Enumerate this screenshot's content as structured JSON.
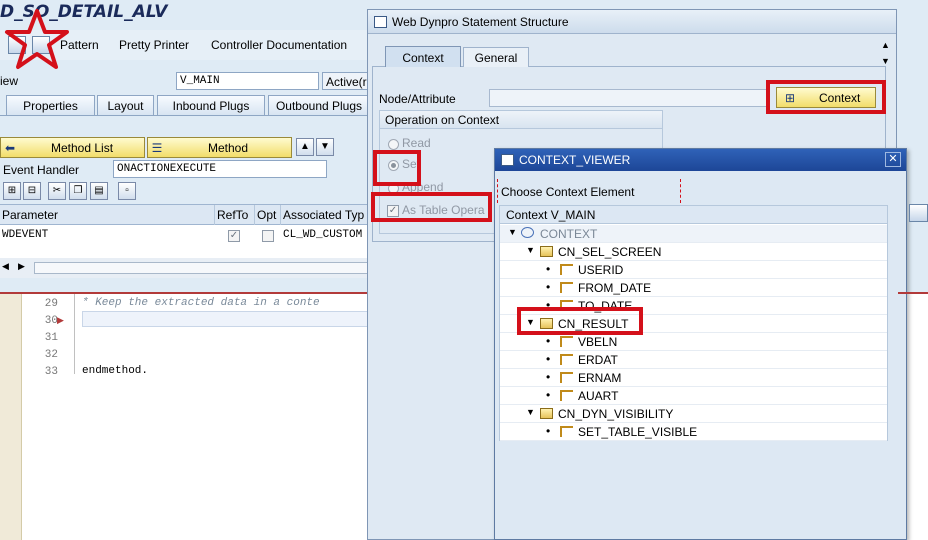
{
  "background": {
    "program_title": "D_SO_DETAIL_ALV",
    "toolbar": {
      "pattern": "Pattern",
      "pretty_printer": "Pretty Printer",
      "controller_documentation": "Controller Documentation"
    },
    "view_label": "iew",
    "view_value": "V_MAIN",
    "active_label": "Active(r",
    "tabs": [
      "Properties",
      "Layout",
      "Inbound Plugs",
      "Outbound Plugs"
    ],
    "method_list_button": "Method List",
    "method_button": "Method",
    "event_handler_label": "Event Handler",
    "event_handler_value": "ONACTIONEXECUTE",
    "param_grid": {
      "columns": [
        "Parameter",
        "RefTo",
        "Opt",
        "Associated Typ"
      ],
      "row": {
        "parameter": "WDEVENT",
        "refto": "✓",
        "opt": "",
        "associated_type": "CL_WD_CUSTOM"
      }
    },
    "editor": {
      "line_numbers": [
        "29",
        "30",
        "31",
        "32",
        "33"
      ],
      "comment_line": "* Keep the extracted data in a conte",
      "endmethod": "endmethod."
    }
  },
  "statement_dialog": {
    "title": "Web Dynpro Statement Structure",
    "tabs": {
      "context": "Context",
      "general": "General"
    },
    "node_attribute_label": "Node/Attribute",
    "context_button": "Context",
    "operation_group": {
      "title": "Operation on Context",
      "options": {
        "read": "Read",
        "set": "Set",
        "append": "Append"
      },
      "as_table_operation": "As Table Opera"
    }
  },
  "context_viewer": {
    "title": "CONTEXT_VIEWER",
    "choose_label": "Choose Context Element",
    "tree_header": "Context V_MAIN",
    "tree": {
      "root": "CONTEXT",
      "sel_screen": "CN_SEL_SCREEN",
      "userid": "USERID",
      "from_date": "FROM_DATE",
      "to_date": "TO_DATE",
      "result": "CN_RESULT",
      "vbeln": "VBELN",
      "erdat": "ERDAT",
      "ernam": "ERNAM",
      "auart": "AUART",
      "dyn_visibility": "CN_DYN_VISIBILITY",
      "set_table_visible": "SET_TABLE_VISIBLE"
    }
  },
  "colors": {
    "annotation_red": "#d4101a",
    "dialog_title_blue": "#1d4697",
    "button_yellow": "#f2dd6a",
    "sap_background": "#dfebf5"
  }
}
